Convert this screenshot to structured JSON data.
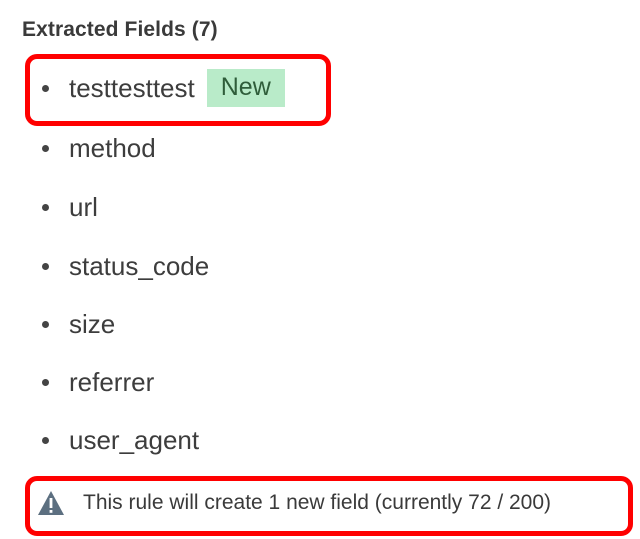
{
  "section": {
    "title": "Extracted Fields (7)"
  },
  "fields": [
    {
      "name": "testtesttest",
      "badge": "New"
    },
    {
      "name": "method"
    },
    {
      "name": "url"
    },
    {
      "name": "status_code"
    },
    {
      "name": "size"
    },
    {
      "name": "referrer"
    },
    {
      "name": "user_agent"
    }
  ],
  "warning": {
    "icon": "warning-triangle-icon",
    "message": "This rule will create 1 new field (currently 72 / 200)"
  },
  "colors": {
    "highlight": "#ff0000",
    "badge_bg": "#b9ebc9",
    "badge_text": "#2f5d3a",
    "warning_icon": "#5c6f80"
  }
}
